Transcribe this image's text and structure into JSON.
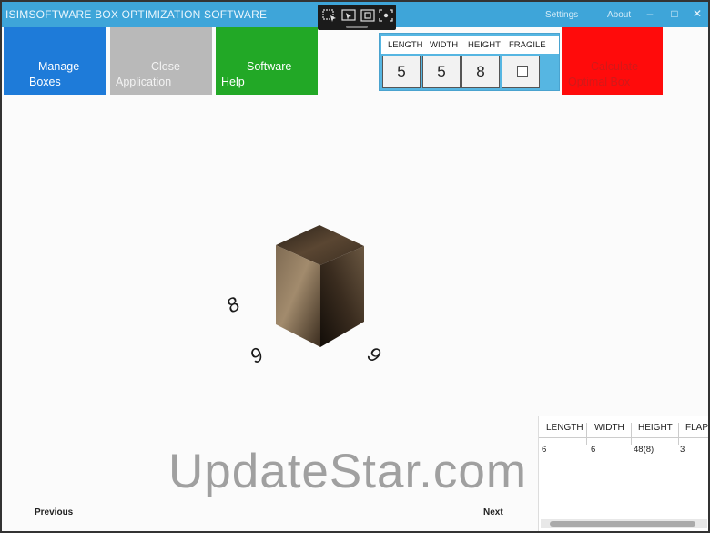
{
  "window": {
    "title": "ISIMSOFTWARE BOX OPTIMIZATION SOFTWARE",
    "settings_label": "Settings",
    "about_label": "About",
    "minimize_glyph": "–",
    "maximize_glyph": "□",
    "close_glyph": "✕"
  },
  "overlay_toolbar": {
    "icons": [
      "select-region-icon",
      "pointer-window-icon",
      "fullscreen-icon",
      "capture-region-icon"
    ]
  },
  "tiles": {
    "manage": {
      "line1": "Manage",
      "line2": "Boxes"
    },
    "close": {
      "line1": "Close",
      "line2": "Application"
    },
    "help": {
      "line1": "Software",
      "line2": "Help"
    },
    "calculate": {
      "line1": "Calculate",
      "line2": "Optimal Box"
    }
  },
  "dimensions": {
    "headers": {
      "length": "LENGTH",
      "width": "WIDTH",
      "height": "HEIGHT",
      "fragile": "FRAGILE"
    },
    "length": "5",
    "width": "5",
    "height": "8",
    "fragile_checked": false
  },
  "viewport_labels": {
    "height_label": "8",
    "length_label": "6",
    "width_label": "6"
  },
  "results": {
    "headers": {
      "length": "LENGTH",
      "width": "WIDTH",
      "height": "HEIGHT",
      "flap": "FLAP"
    },
    "rows": [
      {
        "length": "6",
        "width": "6",
        "height": "48(8)",
        "flap": "3"
      }
    ]
  },
  "navigation": {
    "previous": "Previous",
    "next": "Next"
  },
  "watermark": "UpdateStar.com",
  "colors": {
    "titlebar": "#3ea5d9",
    "manage_tile": "#1e7bd9",
    "close_tile": "#b9b9b9",
    "help_tile": "#22a826",
    "calculate_tile": "#ff0b0b",
    "dims_panel": "#56b6e2"
  }
}
